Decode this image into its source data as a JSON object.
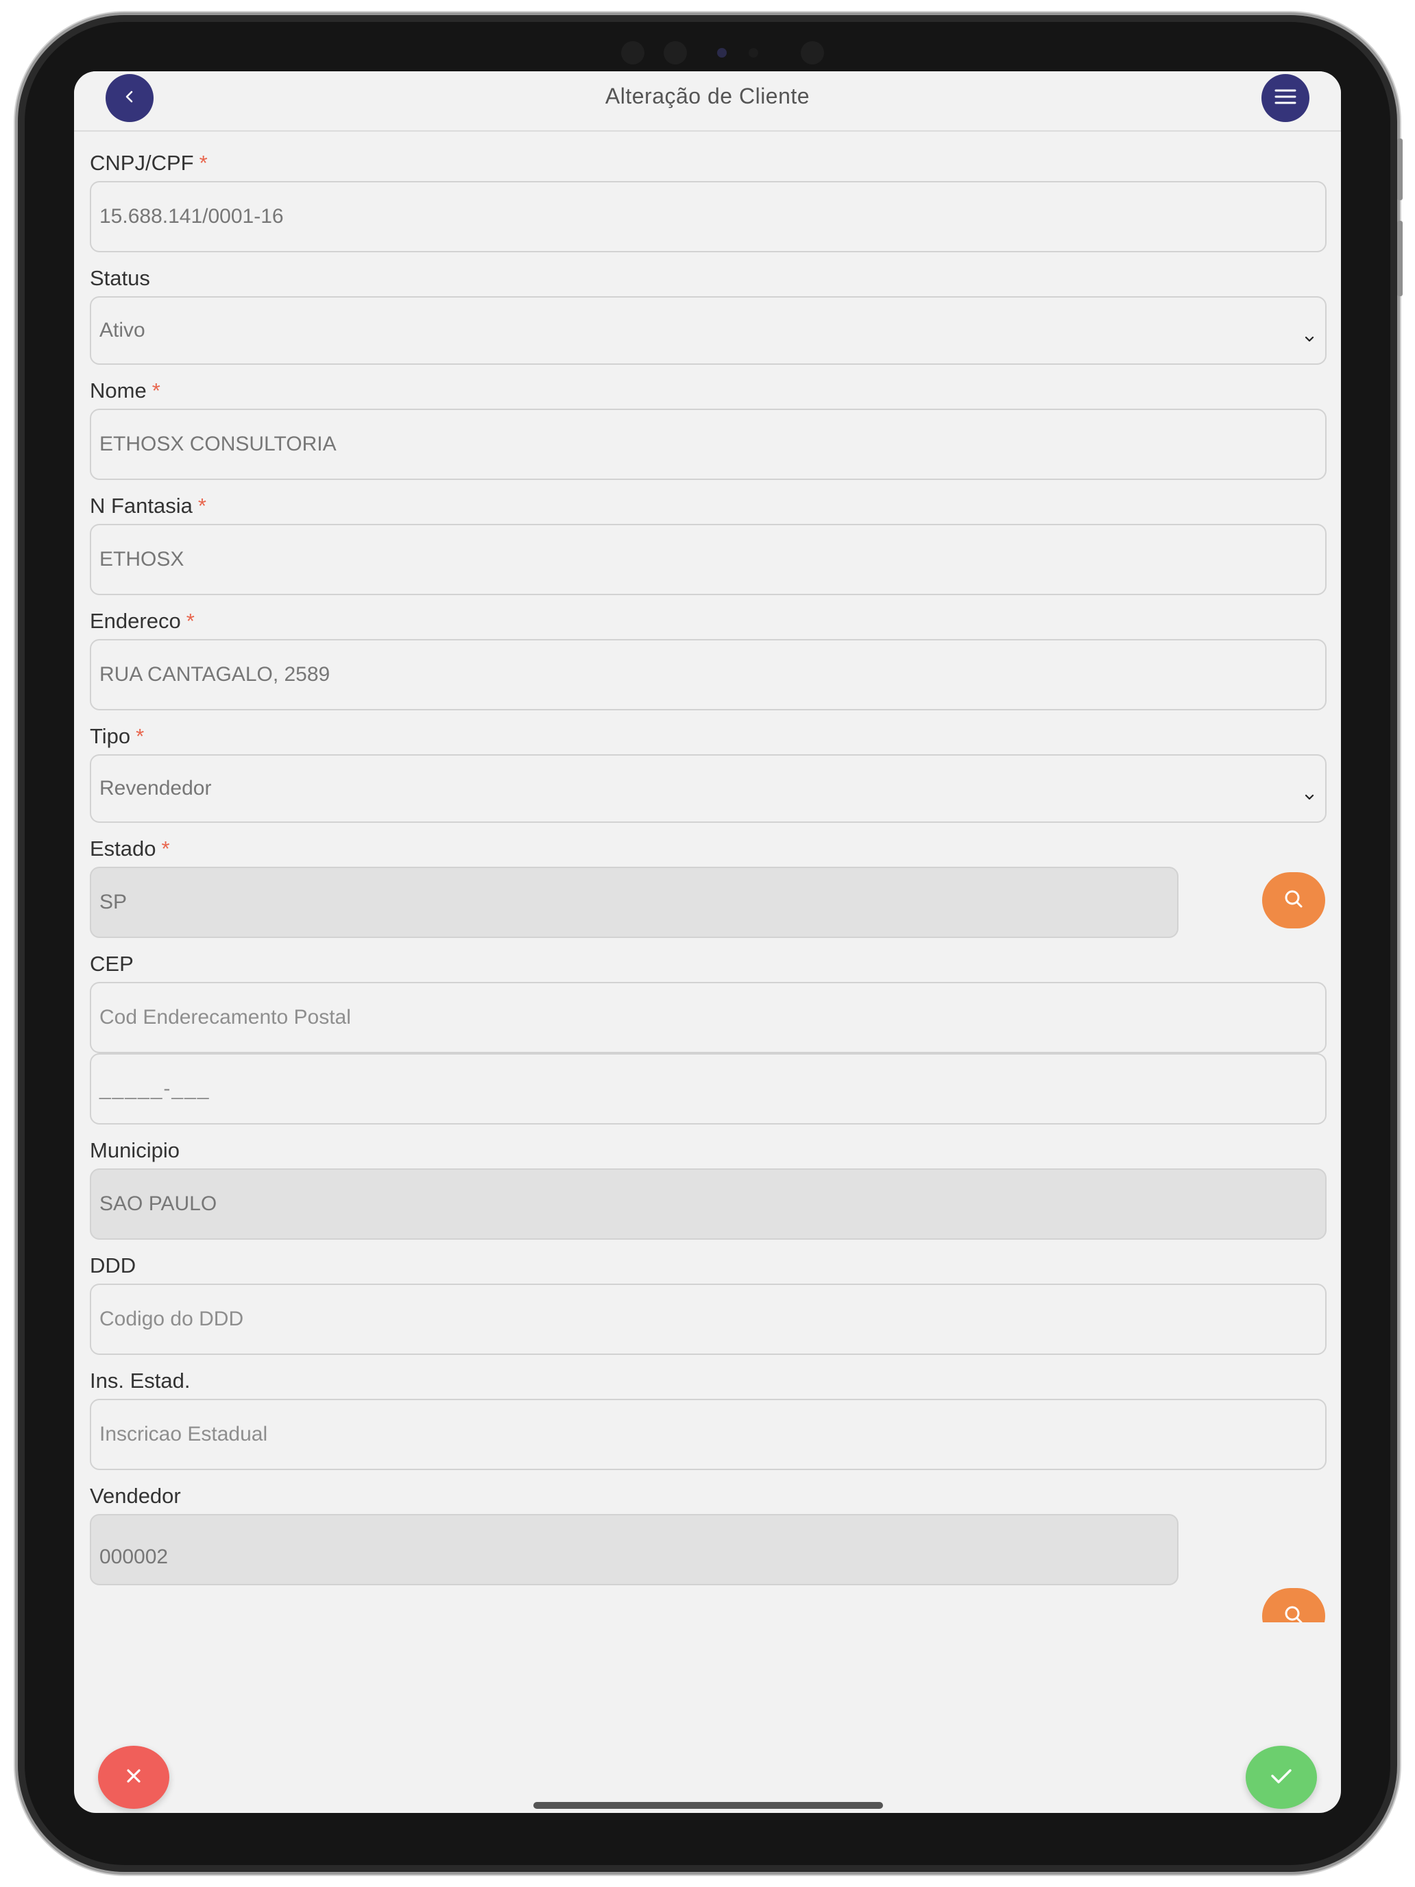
{
  "header": {
    "title": "Alteração de Cliente",
    "back_icon": "chevron-left-icon",
    "menu_icon": "hamburger-menu-icon",
    "accent_color": "#35347a"
  },
  "form": {
    "required_marker": "*",
    "cnpj": {
      "label": "CNPJ/CPF",
      "value": "15.688.141/0001-16"
    },
    "status": {
      "label": "Status",
      "value": "Ativo"
    },
    "nome": {
      "label": "Nome",
      "value": "ETHOSX CONSULTORIA"
    },
    "fantasia": {
      "label": "N Fantasia",
      "value": "ETHOSX"
    },
    "endereco": {
      "label": "Endereco",
      "value": "RUA CANTAGALO, 2589"
    },
    "tipo": {
      "label": "Tipo",
      "value": "Revendedor"
    },
    "estado": {
      "label": "Estado",
      "value": "SP"
    },
    "cep": {
      "label": "CEP",
      "placeholder": "Cod Enderecamento Postal",
      "mask": "_____-___"
    },
    "municipio": {
      "label": "Municipio",
      "value": "SAO PAULO"
    },
    "ddd": {
      "label": "DDD",
      "placeholder": "Codigo do DDD"
    },
    "ins_estad": {
      "label": "Ins. Estad.",
      "placeholder": "Inscricao Estadual"
    },
    "vendedor": {
      "label": "Vendedor",
      "value": "000002"
    }
  },
  "actions": {
    "cancel_icon": "close-icon",
    "confirm_icon": "check-icon",
    "cancel_color": "#f05f5a",
    "confirm_color": "#6ccf6e",
    "search_color": "#f08a45"
  }
}
